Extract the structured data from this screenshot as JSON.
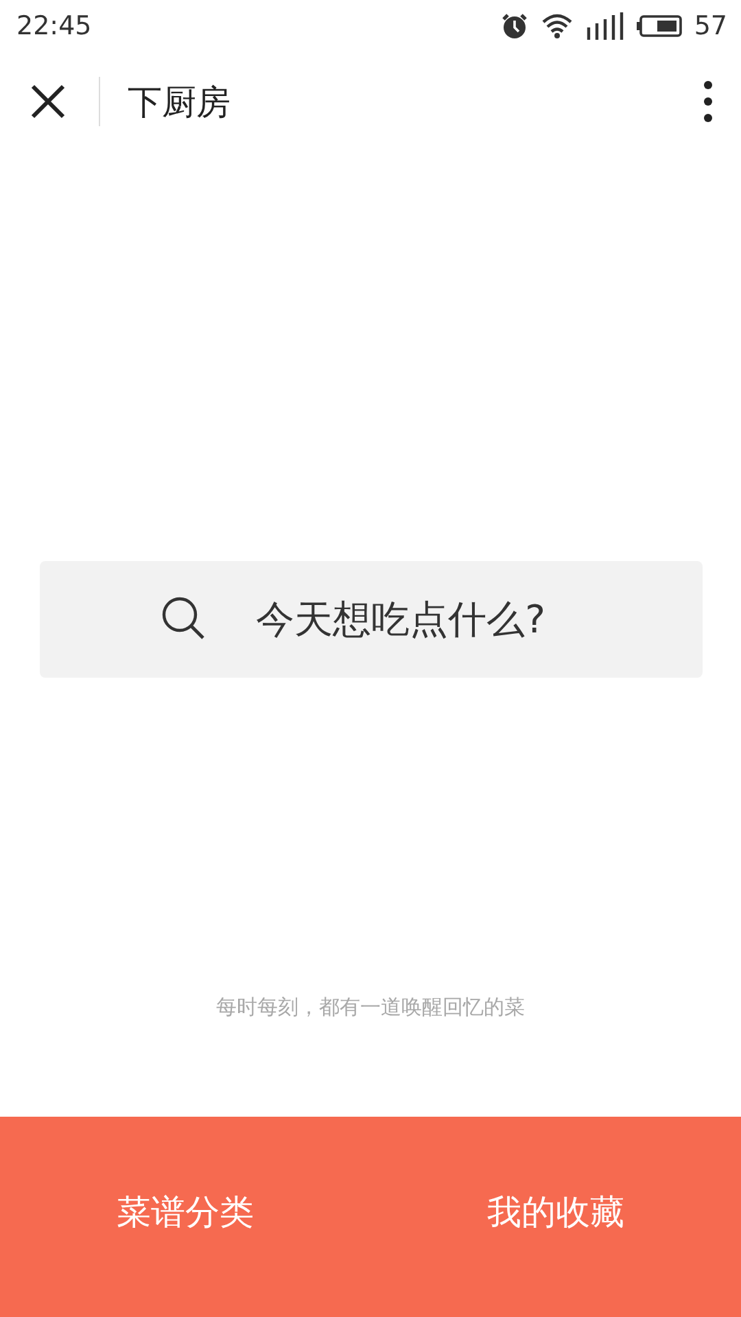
{
  "status_bar": {
    "time": "22:45",
    "battery": "57"
  },
  "nav_bar": {
    "title": "下厨房"
  },
  "search": {
    "placeholder": "今天想吃点什么?"
  },
  "tagline": "每时每刻，都有一道唤醒回忆的菜",
  "bottom_tabs": [
    {
      "label": "菜谱分类"
    },
    {
      "label": "我的收藏"
    }
  ]
}
